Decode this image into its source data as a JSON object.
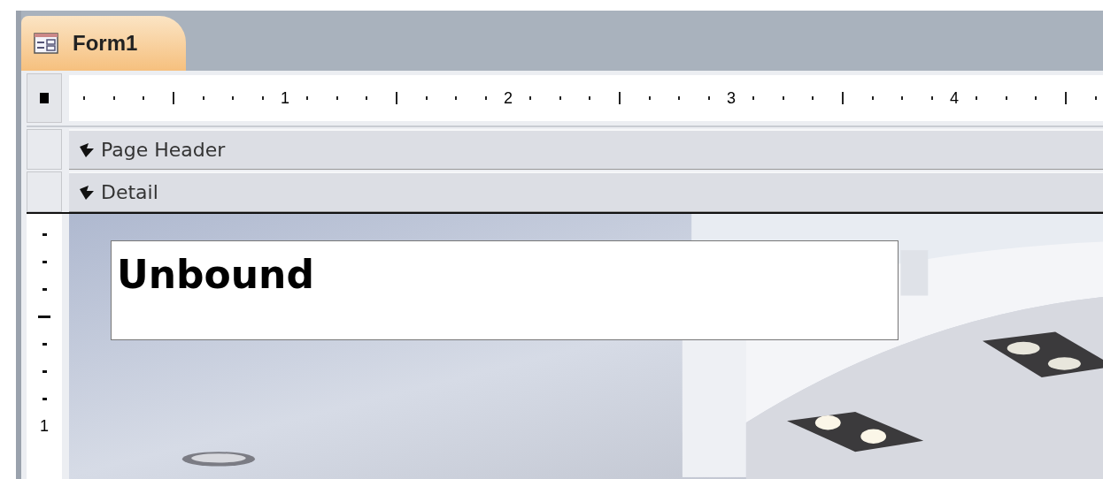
{
  "tab": {
    "title": "Form1",
    "selected": true
  },
  "ruler": {
    "labels": [
      "1",
      "2",
      "3",
      "4"
    ]
  },
  "vertical_ruler": {
    "labels": [
      "1"
    ]
  },
  "sections": [
    {
      "label": "Page Header"
    },
    {
      "label": "Detail"
    }
  ],
  "detail": {
    "text_box": {
      "value": "Unbound"
    }
  }
}
